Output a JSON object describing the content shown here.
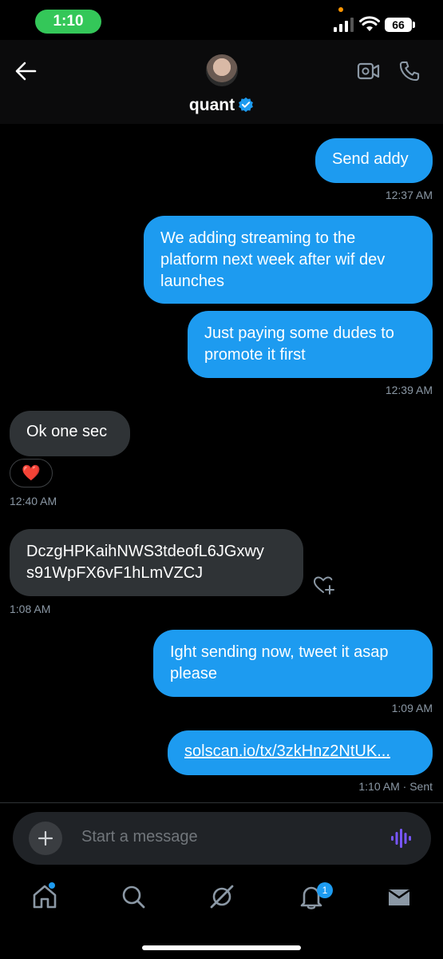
{
  "status_bar": {
    "time": "1:10",
    "battery": "66"
  },
  "header": {
    "name": "quant"
  },
  "messages": [
    {
      "text": "Send addy",
      "time": "12:37 AM"
    },
    {
      "text": "We adding streaming to the platform next week after wif dev launches"
    },
    {
      "text": "Just paying some dudes to promote it first",
      "time": "12:39 AM"
    },
    {
      "text": "Ok one sec",
      "reaction": "❤️",
      "time": "12:40 AM"
    },
    {
      "text_line1": "DczgHPKaihNWS3tdeofL6JGxwy",
      "text_line2": "s91WpFX6vF1hLmVZCJ",
      "time": "1:08 AM"
    },
    {
      "text": "Ight sending now, tweet it asap please",
      "time": "1:09 AM"
    },
    {
      "text": "solscan.io/tx/3zkHnz2NtUK...",
      "time": "1:10 AM",
      "status": " · Sent"
    }
  ],
  "composer": {
    "placeholder": "Start a message"
  },
  "nav": {
    "notifications_badge": "1"
  },
  "colors": {
    "accent": "#1d9bf0",
    "incoming": "#2f3336",
    "background": "#000000"
  }
}
